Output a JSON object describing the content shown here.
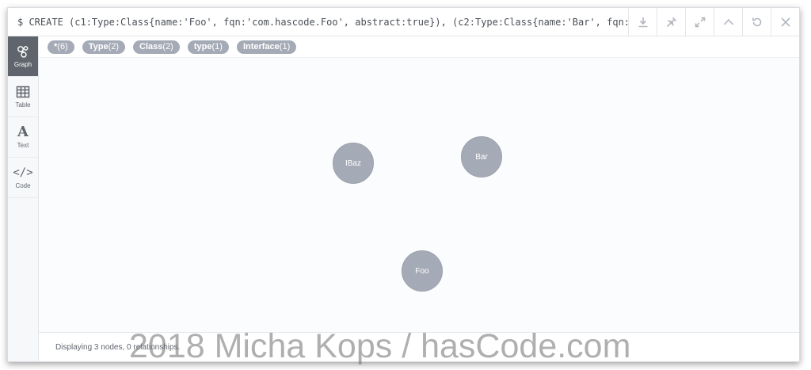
{
  "query": "$ CREATE (c1:Type:Class{name:'Foo', fqn:'com.hascode.Foo', abstract:true}), (c2:Type:Class{name:'Bar', fqn:'c…",
  "toolbar": {
    "icons": [
      "download-icon",
      "pin-icon",
      "expand-icon",
      "collapse-up-icon",
      "rerun-icon",
      "close-icon"
    ]
  },
  "sidebar": {
    "items": [
      {
        "label": "Graph",
        "icon": "graph-icon"
      },
      {
        "label": "Table",
        "icon": "table-icon"
      },
      {
        "label": "Text",
        "icon": "text-icon"
      },
      {
        "label": "Code",
        "icon": "code-icon"
      }
    ]
  },
  "tags": [
    {
      "name": "*",
      "count": "(6)"
    },
    {
      "name": "Type",
      "count": "(2)"
    },
    {
      "name": "Class",
      "count": "(2)"
    },
    {
      "name": "type",
      "count": "(1)"
    },
    {
      "name": "Interface",
      "count": "(1)"
    }
  ],
  "nodes": [
    {
      "label": "IBaz"
    },
    {
      "label": "Bar"
    },
    {
      "label": "Foo"
    }
  ],
  "status": "Displaying 3 nodes, 0 relationships.",
  "watermark": "2018 Micha Kops / hasCode.com",
  "colors": {
    "node": "#a5abb6",
    "sidebar_active": "#60656d"
  }
}
